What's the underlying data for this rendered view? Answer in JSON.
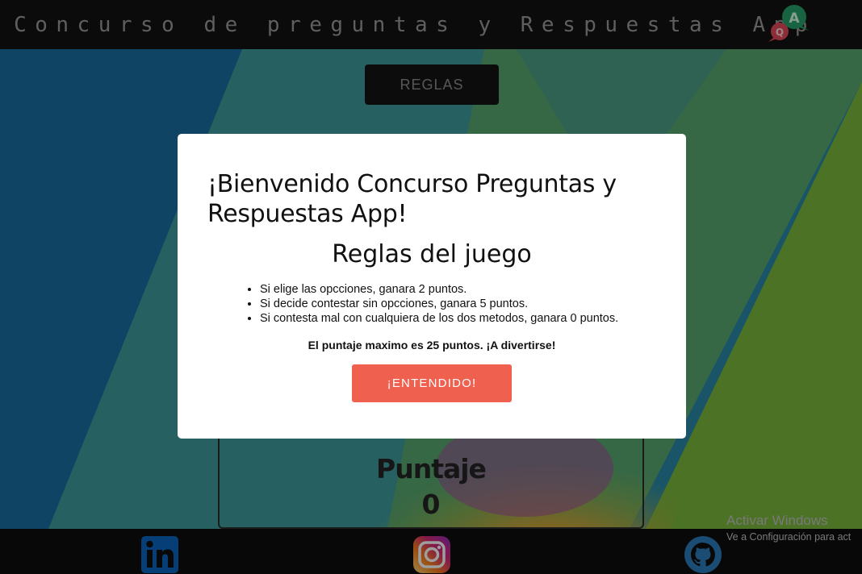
{
  "header": {
    "title": "Concurso de preguntas y Respuestas App",
    "logo_q": "Q",
    "logo_a": "A"
  },
  "main": {
    "rules_button": "REGLAS",
    "score_label": "Puntaje",
    "score_value": "0"
  },
  "modal": {
    "title": "¡Bienvenido Concurso Preguntas y Respuestas App!",
    "subtitle": "Reglas del juego",
    "rules": [
      "Si elige las opcciones, ganara 2 puntos.",
      "Si decide contestar sin opcciones, ganara 5 puntos.",
      "Si contesta mal con cualquiera de los dos metodos, ganara 0 puntos."
    ],
    "max_score": "El puntaje maximo es 25 puntos. ¡A divertirse!",
    "ok_button": "¡ENTENDIDO!"
  },
  "footer": {
    "icons": [
      "linkedin-icon",
      "instagram-icon",
      "github-icon"
    ]
  },
  "watermark": {
    "title": "Activar Windows",
    "subtitle": "Ve a Configuración para act"
  },
  "colors": {
    "accent": "#f0604f",
    "header_bg": "#131313",
    "footer_bg": "#0e0e0e"
  }
}
